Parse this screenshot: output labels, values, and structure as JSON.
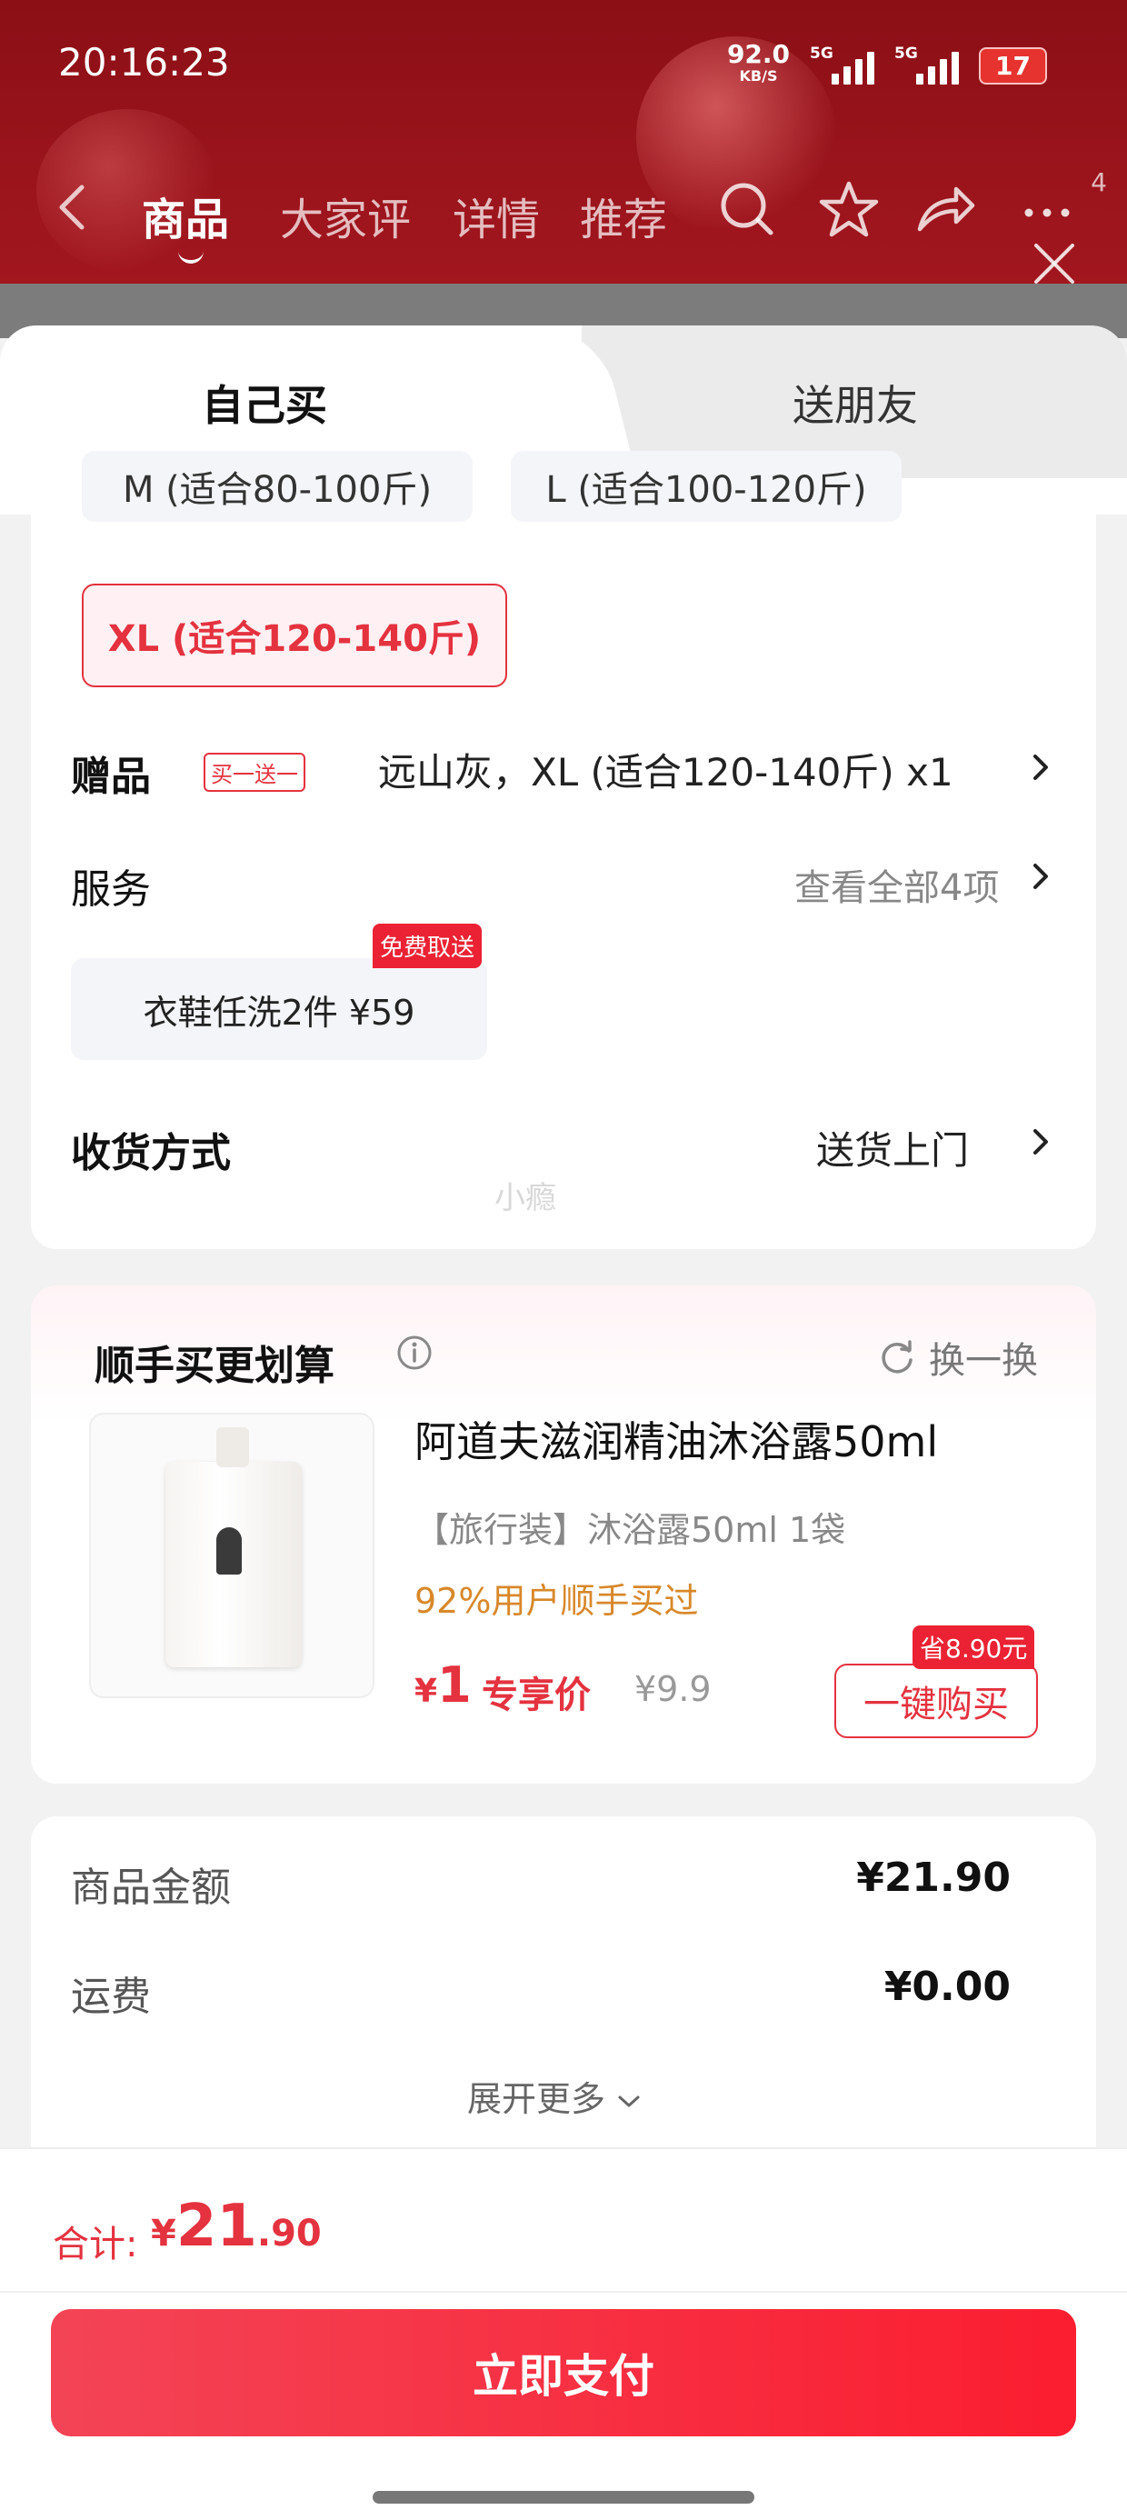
{
  "status_bar": {
    "time": "20:16:23",
    "net_speed": "92.0",
    "net_unit": "KB/S",
    "sim1": "5G",
    "sim2": "5G",
    "battery": "17"
  },
  "nav": {
    "tabs": [
      "商品",
      "大家评",
      "详情",
      "推荐"
    ],
    "active_tab": "商品",
    "more_count": "4"
  },
  "sheet_tabs": {
    "self": "自己买",
    "friend": "送朋友"
  },
  "sizes": {
    "options": [
      "M (适合80-100斤)",
      "L (适合100-120斤)",
      "XL (适合120-140斤)"
    ],
    "selected": "XL (适合120-140斤)"
  },
  "gift": {
    "label": "赠品",
    "tag": "买一送一",
    "value": "远山灰，XL (适合120-140斤) x1"
  },
  "service": {
    "label": "服务",
    "view_all": "查看全部4项",
    "item": "衣鞋任洗2件  ¥59",
    "item_tag": "免费取送"
  },
  "delivery": {
    "label": "收货方式",
    "value": "送货上门"
  },
  "watermark": "小瘾",
  "bundle": {
    "title": "顺手买更划算",
    "swap": "换一换",
    "product_name": "阿道夫滋润精油沐浴露50ml",
    "spec": "【旅行装】沐浴露50ml 1袋",
    "buyers": "92%用户顺手买过",
    "price_symbol": "¥",
    "price": "1",
    "exclusive": "专享价",
    "old_price": "¥9.9",
    "buy_button": "一键购买",
    "save_tag": "省8.90元"
  },
  "summary": {
    "goods_label": "商品金额",
    "goods_value": "¥21.90",
    "shipping_label": "运费",
    "shipping_value": "¥0.00",
    "expand": "展开更多"
  },
  "footer": {
    "total_label": "合计:",
    "total_symbol": "¥",
    "total_int": "21",
    "total_dec": ".90",
    "pay_button": "立即支付"
  },
  "colors": {
    "accent": "#e4323f",
    "header_red": "#9a141c",
    "pay_button": "#fb1d30"
  }
}
